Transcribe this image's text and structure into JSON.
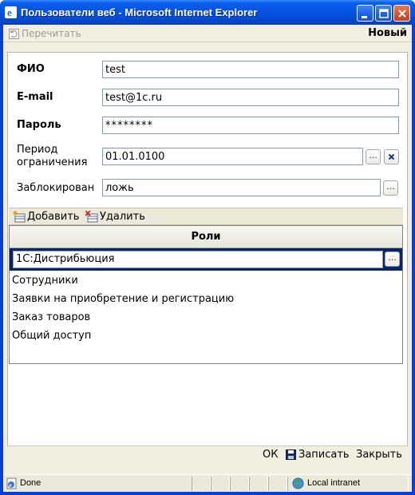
{
  "window": {
    "title": "Пользователи веб - Microsoft Internet Explorer"
  },
  "toolbar": {
    "reread_label": "Перечитать",
    "mode_label": "Новый"
  },
  "form": {
    "fio_label": "ФИО",
    "fio_value": "test",
    "email_label": "E-mail",
    "email_value": "test@1c.ru",
    "password_label": "Пароль",
    "password_value": "********",
    "period_label_line1": "Период",
    "period_label_line2": "ограничения",
    "period_value": "01.01.0100",
    "blocked_label": "Заблокирован",
    "blocked_value": "ложь",
    "dots_symbol": "..."
  },
  "roles": {
    "add_label": "Добавить",
    "delete_label": "Удалить",
    "column_header": "Роли",
    "rows": [
      "1С:Дистрибьюция",
      "Сотрудники",
      "Заявки на приобретение и регистрацию",
      "Заказ товаров",
      "Общий доступ"
    ]
  },
  "actions": {
    "ok_label": "ОК",
    "save_label": "Записать",
    "close_label": "Закрыть"
  },
  "statusbar": {
    "status_text": "Done",
    "zone_text": "Local intranet"
  },
  "colors": {
    "titlebar": "#0553e0",
    "selected_row": "#0a246a",
    "client_bg": "#f3efe0"
  }
}
